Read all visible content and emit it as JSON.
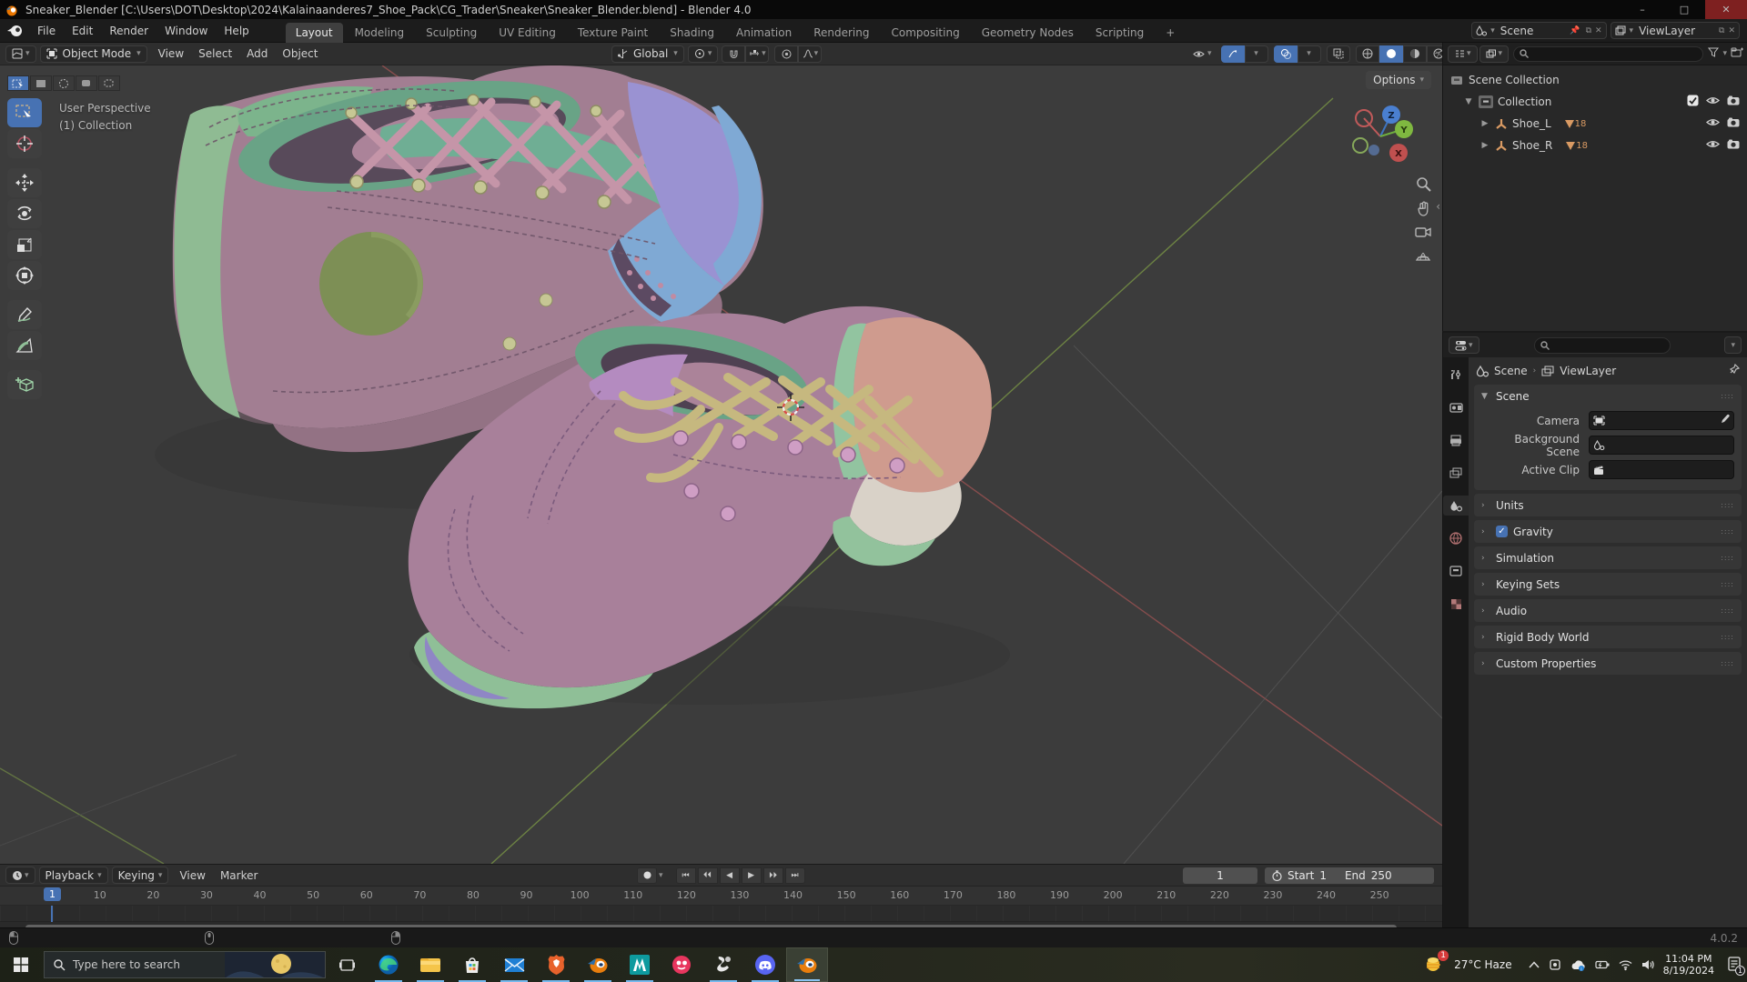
{
  "window": {
    "title": "Sneaker_Blender [C:\\Users\\DOT\\Desktop\\2024\\Kalainaanderes7_Shoe_Pack\\CG_Trader\\Sneaker\\Sneaker_Blender.blend] - Blender 4.0",
    "minimize": "–",
    "maximize": "□",
    "close": "✕"
  },
  "menubar": {
    "menus": [
      "File",
      "Edit",
      "Render",
      "Window",
      "Help"
    ],
    "tabs": [
      "Layout",
      "Modeling",
      "Sculpting",
      "UV Editing",
      "Texture Paint",
      "Shading",
      "Animation",
      "Rendering",
      "Compositing",
      "Geometry Nodes",
      "Scripting"
    ],
    "active_tab": "Layout",
    "add_tab": "+",
    "scene": "Scene",
    "viewlayer": "ViewLayer"
  },
  "toolheader": {
    "mode": "Object Mode",
    "menus": [
      "View",
      "Select",
      "Add",
      "Object"
    ],
    "orientation": "Global",
    "options": "Options"
  },
  "viewport": {
    "overlay_line1": "User Perspective",
    "overlay_line2": "(1) Collection",
    "axis": {
      "x": "X",
      "y": "Y",
      "z": "Z"
    }
  },
  "outliner": {
    "rows": [
      {
        "label": "Scene Collection"
      },
      {
        "label": "Collection"
      },
      {
        "label": "Shoe_L",
        "badge": "18"
      },
      {
        "label": "Shoe_R",
        "badge": "18"
      }
    ]
  },
  "properties": {
    "breadcrumb_scene": "Scene",
    "breadcrumb_viewlayer": "ViewLayer",
    "scene_section": "Scene",
    "fields": [
      {
        "label": "Camera"
      },
      {
        "label": "Background Scene"
      },
      {
        "label": "Active Clip"
      }
    ],
    "panels": [
      "Units",
      "Gravity",
      "Simulation",
      "Keying Sets",
      "Audio",
      "Rigid Body World",
      "Custom Properties"
    ],
    "gravity_checked": "✓"
  },
  "timeline": {
    "menus": [
      "Playback",
      "Keying",
      "View",
      "Marker"
    ],
    "current_frame": "1",
    "start_label": "Start",
    "start": "1",
    "end_label": "End",
    "end": "250",
    "ticks": [
      "10",
      "20",
      "30",
      "40",
      "50",
      "60",
      "70",
      "80",
      "90",
      "100",
      "110",
      "120",
      "130",
      "140",
      "150",
      "160",
      "170",
      "180",
      "190",
      "200",
      "210",
      "220",
      "230",
      "240",
      "250"
    ]
  },
  "statusbar": {
    "version": "4.0.2"
  },
  "taskbar": {
    "search_placeholder": "Type here to search",
    "apps": [
      "edge",
      "file-explorer",
      "store",
      "mail",
      "brave",
      "blender",
      "maya",
      "medibang",
      "zbrush",
      "discord",
      "blender-active"
    ],
    "weather": "27°C Haze",
    "time": "11:04 PM",
    "date": "8/19/2024",
    "badge": "1"
  }
}
